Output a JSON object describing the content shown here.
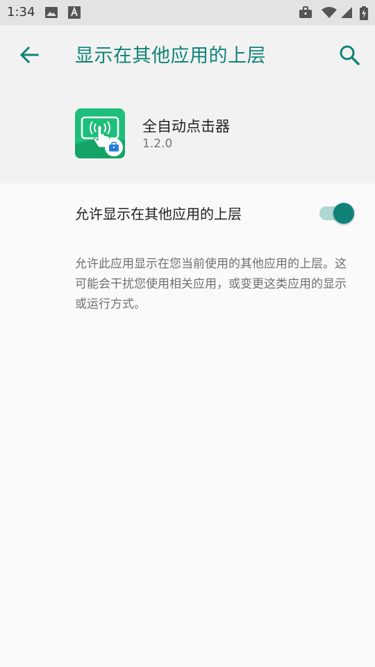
{
  "status_bar": {
    "time": "1:34",
    "icons": [
      "image-icon",
      "text-a-icon",
      "briefcase-icon",
      "wifi-icon",
      "signal-icon",
      "battery-charging-icon"
    ]
  },
  "app_bar": {
    "title": "显示在其他应用的上层",
    "back_icon": "arrow-left-icon",
    "search_icon": "search-icon"
  },
  "app_header": {
    "name": "全自动点击器",
    "version": "1.2.0",
    "icon": "tap-hand-icon"
  },
  "setting": {
    "label": "允许显示在其他应用的上层",
    "enabled": true
  },
  "description": "允许此应用显示在您当前使用的其他应用的上层。这可能会干扰您使用相关应用，或变更这类应用的显示或运行方式。",
  "colors": {
    "accent": "#0f8378",
    "toggle_track": "#aed8d3",
    "app_icon_green": "#1dbf7a"
  }
}
